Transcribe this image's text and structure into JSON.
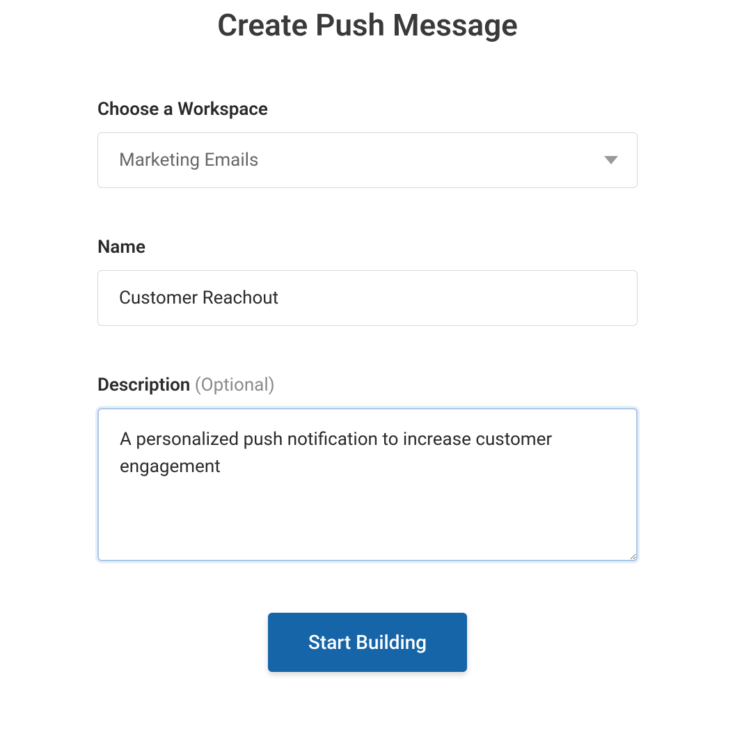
{
  "page": {
    "title": "Create Push Message"
  },
  "form": {
    "workspace": {
      "label": "Choose a Workspace",
      "selected": "Marketing Emails"
    },
    "name": {
      "label": "Name",
      "value": "Customer Reachout"
    },
    "description": {
      "label": "Description ",
      "optional": "(Optional)",
      "value": "A personalized push notification to increase customer engagement"
    },
    "submit": {
      "label": "Start Building"
    }
  }
}
